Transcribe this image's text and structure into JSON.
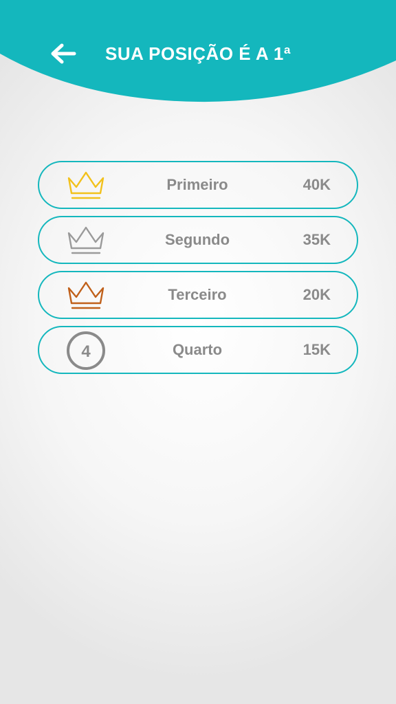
{
  "colors": {
    "accent": "#14b7bd",
    "text_muted": "#8a8a8a",
    "gold": "#f2c11b",
    "silver": "#9a9a9a",
    "bronze": "#c0601a",
    "header_text": "#ffffff"
  },
  "header": {
    "title": "SUA POSIÇÃO É A 1ª",
    "back_icon": "arrow-left-icon"
  },
  "ranking": [
    {
      "label": "Primeiro",
      "points": "40K",
      "icon": "gold-crown-icon"
    },
    {
      "label": "Segundo",
      "points": "35K",
      "icon": "silver-crown-icon"
    },
    {
      "label": "Terceiro",
      "points": "20K",
      "icon": "bronze-crown-icon"
    },
    {
      "label": "Quarto",
      "points": "15K",
      "icon": "number-badge-icon",
      "badge_number": "4"
    }
  ]
}
